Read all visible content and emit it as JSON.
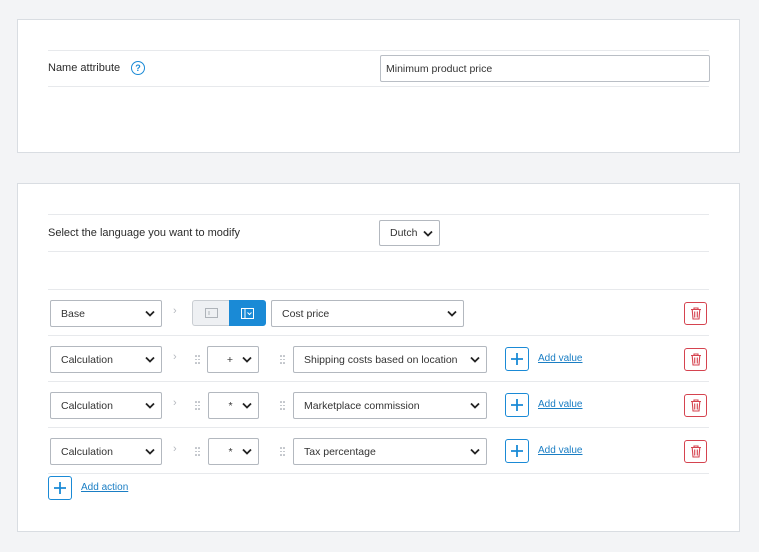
{
  "name_section": {
    "label": "Name attribute",
    "help_icon": "?",
    "value": "Minimum product price"
  },
  "language_section": {
    "label": "Select the language you want to modify",
    "selected": "Dutch"
  },
  "rows": [
    {
      "type": "Base",
      "source": "Cost price"
    },
    {
      "type": "Calculation",
      "operator": "+",
      "value": "Shipping costs based on location",
      "add_value": "Add value"
    },
    {
      "type": "Calculation",
      "operator": "*",
      "value": "Marketplace commission",
      "add_value": "Add value"
    },
    {
      "type": "Calculation",
      "operator": "*",
      "value": "Tax percentage",
      "add_value": "Add value"
    }
  ],
  "add_action": "Add action",
  "icons": {
    "arrow": "›",
    "chevron": "chevron-down-icon",
    "plus": "plus-icon",
    "delete": "trash-icon",
    "drag": "drag-handle-icon"
  },
  "colors": {
    "accent": "#1a8ad6",
    "danger": "#d5434f",
    "background": "#f3f4f6"
  }
}
